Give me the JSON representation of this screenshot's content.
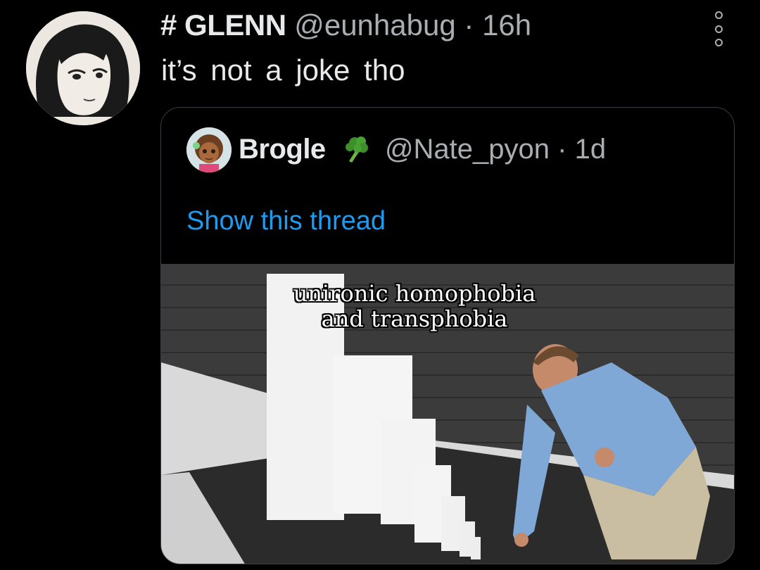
{
  "tweet": {
    "display_name": "# GLENN",
    "handle": "@eunhabug",
    "separator": "·",
    "time": "16h",
    "text": "it’s not a joke tho"
  },
  "quote": {
    "display_name": "Brogle",
    "name_emoji": "broccoli-icon",
    "handle": "@Nate_pyon",
    "separator": "·",
    "time": "1d",
    "show_thread": "Show this thread",
    "image_caption_line1": "unironic homophobia",
    "image_caption_line2": "and transphobia"
  },
  "colors": {
    "background": "#000000",
    "text": "#e7e9ea",
    "muted": "#a9aeb3",
    "link": "#1d9bf0",
    "card_border": "#3a3d41"
  },
  "icons": {
    "more": "more-vertical-icon"
  }
}
